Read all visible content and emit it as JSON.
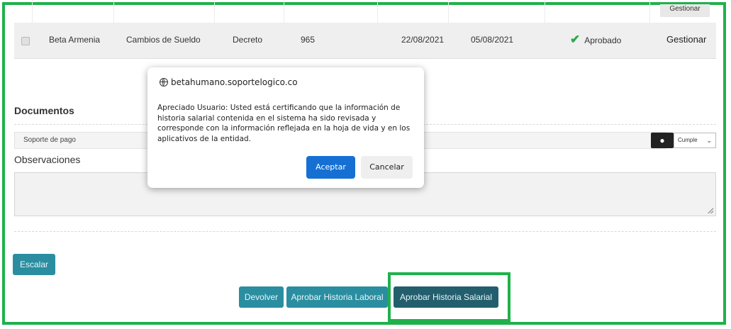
{
  "table": {
    "prev_row_action": "Gestionar",
    "row": {
      "entity": "Beta Armenia",
      "type": "Cambios de Sueldo",
      "document_type": "Decreto",
      "number": "965",
      "date_1": "22/08/2021",
      "date_2": "05/08/2021",
      "status": "Aprobado",
      "action": "Gestionar"
    }
  },
  "documents": {
    "title": "Documentos",
    "item_label": "Soporte de pago",
    "view_icon": "eye-icon",
    "select_value": "Cumple"
  },
  "observations": {
    "label": "Observaciones",
    "value": ""
  },
  "buttons": {
    "escalar": "Escalar",
    "devolver": "Devolver",
    "aprobar_laboral": "Aprobar Historia Laboral",
    "aprobar_salarial": "Aprobar Historia Salarial"
  },
  "dialog": {
    "origin": "betahumano.soportelogico.co",
    "message": "Apreciado Usuario: Usted está certificando que la información de historia salarial contenida en el sistema ha sido revisada y corresponde con la información reflejada en la hoja de vida y en los aplicativos de la entidad.",
    "accept": "Aceptar",
    "cancel": "Cancelar"
  },
  "colors": {
    "highlight": "#1fb14b",
    "teal_button": "#2a8ea0",
    "dark_button": "#235e6d",
    "dialog_primary": "#1670d4",
    "status_check": "#2ea84b"
  }
}
